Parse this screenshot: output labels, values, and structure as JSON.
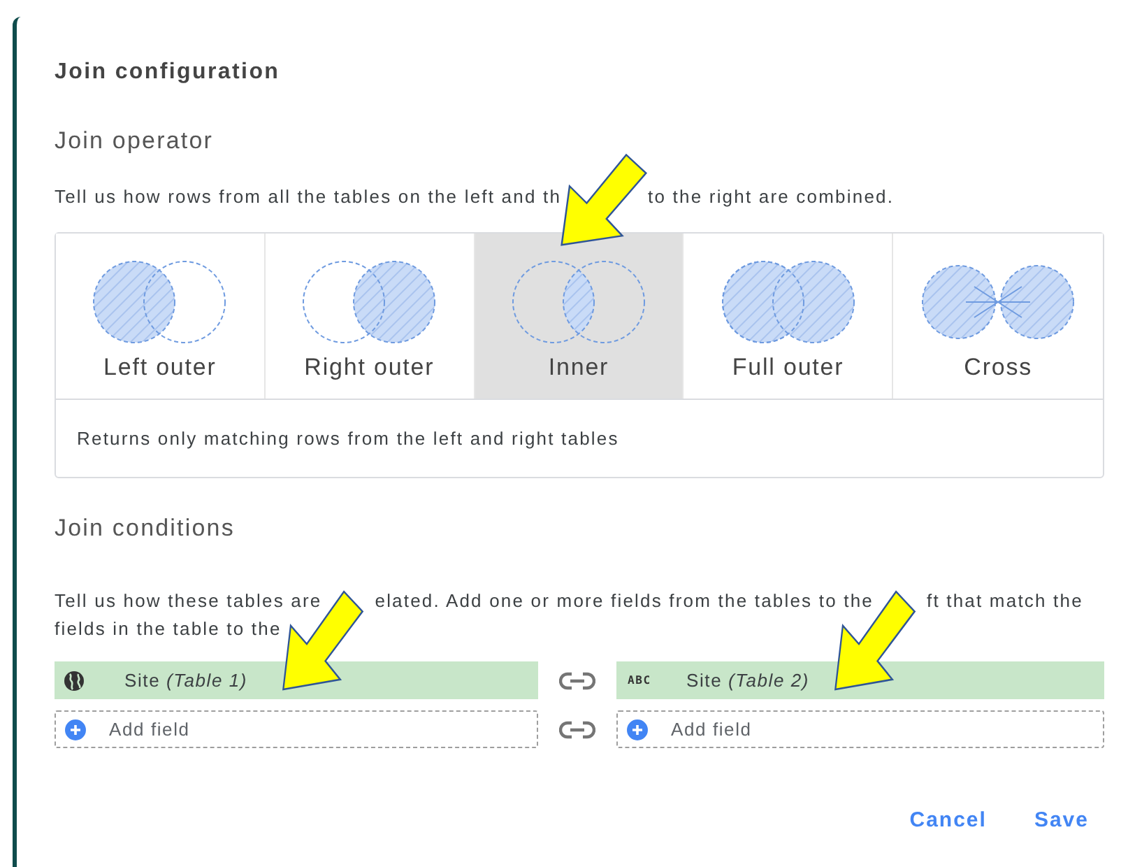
{
  "dialog": {
    "title": "Join configuration"
  },
  "operator": {
    "heading": "Join operator",
    "description": [
      "Tell us how rows from all the tables on the left and th",
      "to the right are combined."
    ],
    "options": [
      {
        "kind": "left",
        "label": "Left outer",
        "selected": false
      },
      {
        "kind": "right",
        "label": "Right outer",
        "selected": false
      },
      {
        "kind": "inner",
        "label": "Inner",
        "selected": true
      },
      {
        "kind": "full",
        "label": "Full outer",
        "selected": false
      },
      {
        "kind": "cross",
        "label": "Cross",
        "selected": false
      }
    ],
    "explanation": "Returns only matching rows from the left and right tables"
  },
  "conditions": {
    "heading": "Join conditions",
    "description_lines": [
      [
        "Tell us how these tables are",
        "elated. Add one or more fields from the tables to the",
        "ft that match the"
      ],
      [
        "fields in the table to the"
      ]
    ],
    "rows": [
      {
        "left": {
          "kind": "geo_field",
          "text": "Site *(Table 1)*"
        },
        "right": {
          "kind": "text_field",
          "badge": "ABC",
          "text": "Site *(Table 2)*"
        }
      },
      {
        "left": {
          "kind": "add",
          "text": "Add field"
        },
        "right": {
          "kind": "add",
          "text": "Add field"
        }
      }
    ]
  },
  "buttons": [
    {
      "label": "Cancel"
    },
    {
      "label": "Save"
    }
  ]
}
